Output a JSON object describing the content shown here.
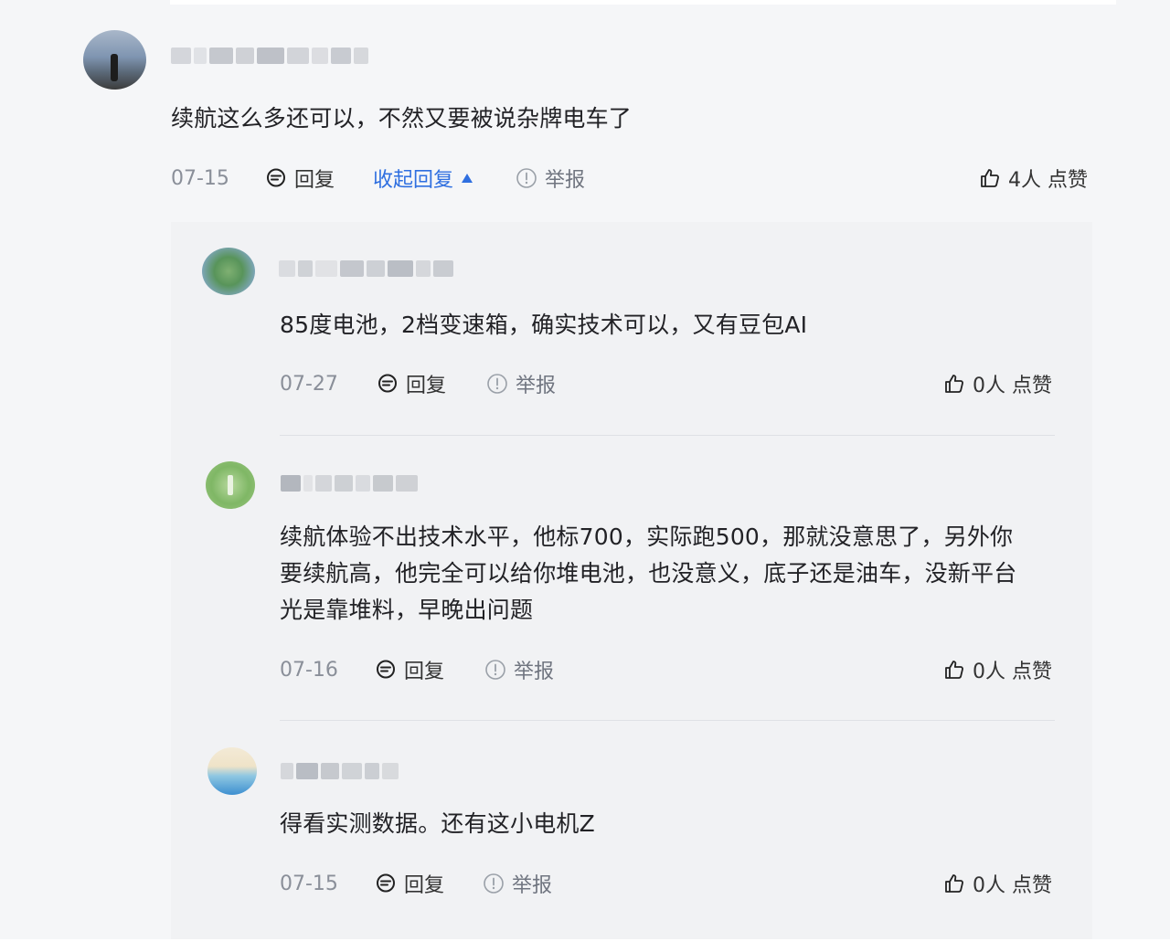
{
  "main_comment": {
    "text": "续航这么多还可以，不然又要被说杂牌电车了",
    "date": "07-15",
    "reply_label": "回复",
    "collapse_label": "收起回复",
    "report_label": "举报",
    "likes": "4人 点赞"
  },
  "replies": [
    {
      "text": "85度电池，2档变速箱，确实技术可以，又有豆包AI",
      "date": "07-27",
      "reply_label": "回复",
      "report_label": "举报",
      "likes": "0人 点赞"
    },
    {
      "text_line1": "续航体验不出技术水平，他标700，实际跑500，那就没意思了，另外你",
      "text_line2": "要续航高，他完全可以给你堆电池，也没意义，底子还是油车，没新平台",
      "text_line3": "光是靠堆料，早晚出问题",
      "date": "07-16",
      "reply_label": "回复",
      "report_label": "举报",
      "likes": "0人 点赞"
    },
    {
      "text": "得看实测数据。还有这小电机Z",
      "date": "07-15",
      "reply_label": "回复",
      "report_label": "举报",
      "likes": "0人 点赞"
    }
  ],
  "colors": {
    "accent": "#2f6fe0",
    "date": "#8a8f99",
    "reply_bg": "#f1f2f4"
  },
  "icons": [
    "reply-icon",
    "report-icon",
    "thumbs-up-icon",
    "caret-up-icon"
  ]
}
